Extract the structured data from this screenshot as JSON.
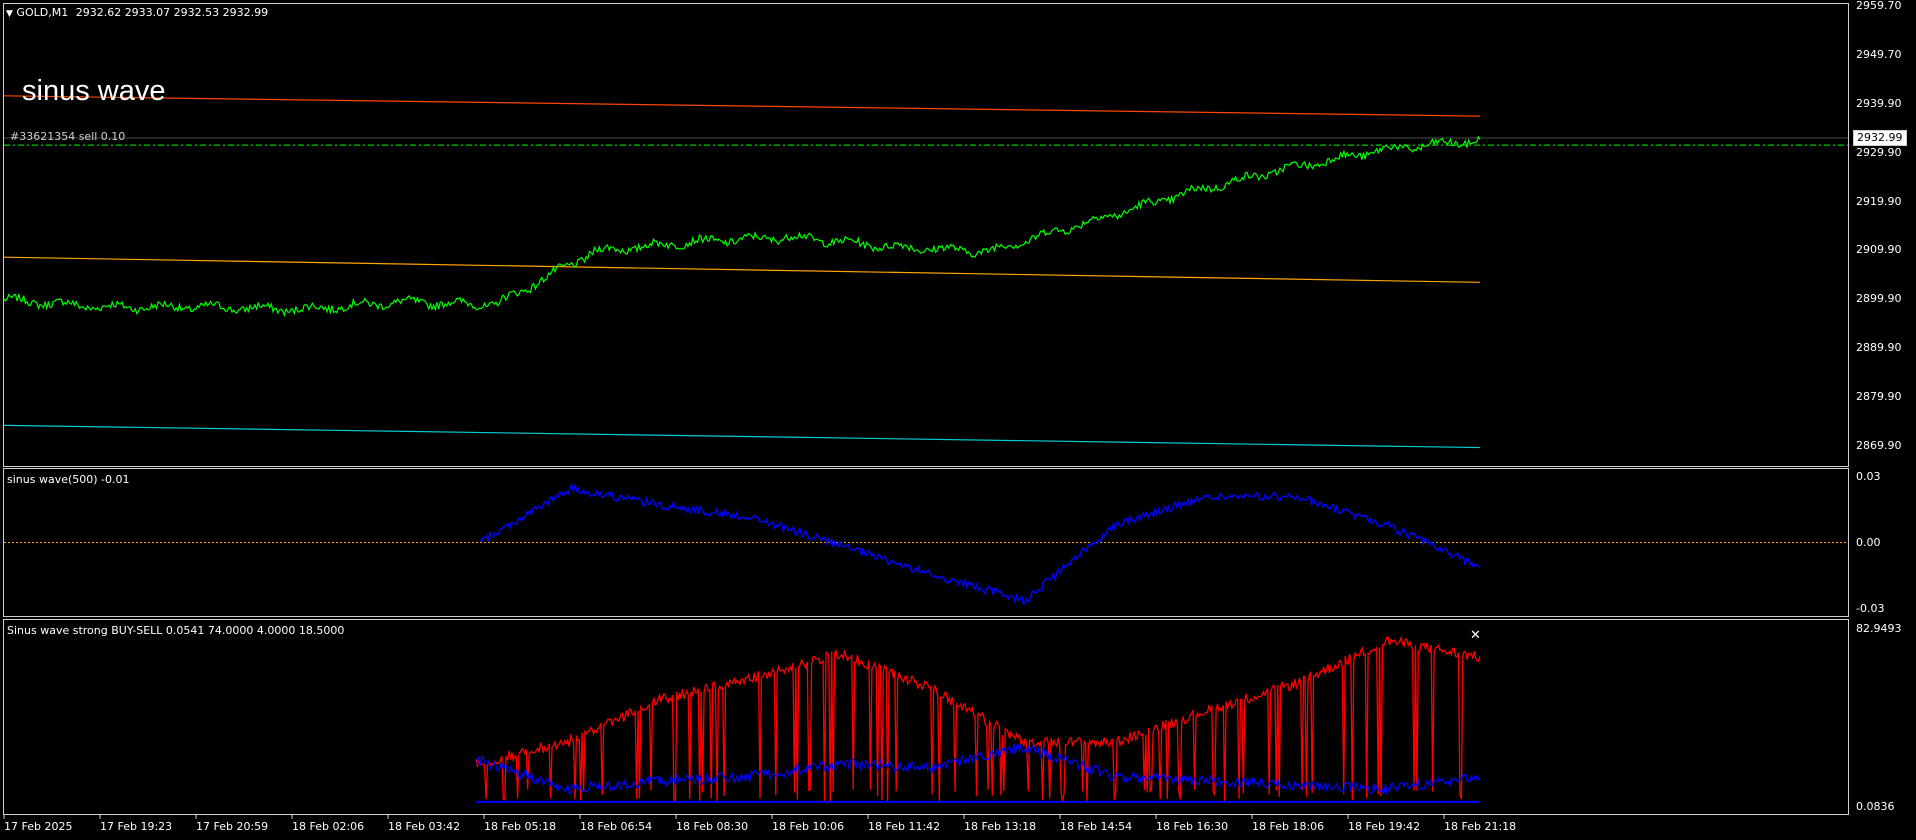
{
  "header": {
    "arrow": "▼",
    "symbol": "GOLD,M1",
    "ohlc": "2932.62 2933.07 2932.53 2932.99"
  },
  "annotation_title": "sinus wave",
  "order_label": "#33621354 sell 0.10",
  "price_axis": [
    "2959.70",
    "2949.70",
    "2939.90",
    "2929.90",
    "2919.90",
    "2909.90",
    "2899.90",
    "2889.90",
    "2879.90",
    "2869.90"
  ],
  "current_price": "2932.99",
  "sine_pane": {
    "title": "sinus wave(500) -0.01",
    "ticks": [
      "0.03",
      "0.00",
      "-0.03"
    ]
  },
  "bs_pane": {
    "title": "Sinus wave strong BUY-SELL 0.0541 74.0000 4.0000 18.5000",
    "ticks": [
      "82.9493",
      "0.0836"
    ]
  },
  "time_axis": [
    "17 Feb 2025",
    "17 Feb 19:23",
    "17 Feb 20:59",
    "18 Feb 02:06",
    "18 Feb 03:42",
    "18 Feb 05:18",
    "18 Feb 06:54",
    "18 Feb 08:30",
    "18 Feb 10:06",
    "18 Feb 11:42",
    "18 Feb 13:18",
    "18 Feb 14:54",
    "18 Feb 16:30",
    "18 Feb 18:06",
    "18 Feb 19:42",
    "18 Feb 21:18"
  ],
  "colors": {
    "price_line": "#00ff00",
    "channel_top": "#ff4500",
    "channel_mid": "#ffa500",
    "channel_low": "#00ced1",
    "order_line": "#00ff00",
    "sine": "#0000ff",
    "zero_line": "#ffa500",
    "buy_sell_red": "#ff0000",
    "buy_sell_blue": "#0000ff"
  },
  "chart_data": [
    {
      "type": "line",
      "title": "GOLD,M1",
      "ylim": [
        2866,
        2961
      ],
      "x": [
        "17 Feb 2025",
        "17 Feb 19:23",
        "17 Feb 20:59",
        "18 Feb 02:06",
        "18 Feb 03:42",
        "18 Feb 05:18",
        "18 Feb 06:54",
        "18 Feb 08:30",
        "18 Feb 10:06",
        "18 Feb 11:42",
        "18 Feb 13:18",
        "18 Feb 14:54",
        "18 Feb 16:30",
        "18 Feb 18:06",
        "18 Feb 19:42",
        "18 Feb 21:18"
      ],
      "series": [
        {
          "values": [
            2900,
            2898.5,
            2898.5,
            2898,
            2899.5,
            2899,
            2910,
            2912,
            2913,
            2911,
            2910,
            2916,
            2922,
            2927,
            2931,
            2932.99
          ]
        }
      ],
      "channels": {
        "top": [
          2942.2,
          2938.0
        ],
        "middle": [
          2908.8,
          2903.6
        ],
        "low": [
          2874.0,
          2869.4
        ]
      },
      "order_line": 2932.0
    },
    {
      "type": "line",
      "title": "sinus wave(500) -0.01",
      "ylim": [
        -0.035,
        0.035
      ],
      "x": [
        "18 Feb 03:42",
        "18 Feb 05:18",
        "18 Feb 06:54",
        "18 Feb 08:30",
        "18 Feb 10:06",
        "18 Feb 11:42",
        "18 Feb 13:18",
        "18 Feb 14:54",
        "18 Feb 16:30",
        "18 Feb 18:06",
        "18 Feb 19:42",
        "18 Feb 21:18"
      ],
      "series": [
        {
          "values": [
            0.0,
            0.026,
            0.018,
            0.012,
            -0.002,
            -0.016,
            -0.028,
            0.009,
            0.022,
            0.022,
            0.008,
            -0.012
          ]
        }
      ]
    },
    {
      "type": "line",
      "title": "Sinus wave strong BUY-SELL 0.0541 74.0000 4.0000 18.5000",
      "ylim": [
        0.0836,
        82.9493
      ],
      "x": [
        "18 Feb 03:42",
        "18 Feb 05:18",
        "18 Feb 06:54",
        "18 Feb 08:30",
        "18 Feb 10:06",
        "18 Feb 11:42",
        "18 Feb 13:18",
        "18 Feb 14:54",
        "18 Feb 16:30",
        "18 Feb 18:06",
        "18 Feb 19:42",
        "18 Feb 21:18"
      ],
      "series": [
        {
          "values": [
            20,
            30,
            50,
            60,
            72,
            55,
            30,
            30,
            45,
            58,
            78,
            70
          ]
        },
        {
          "values": [
            22,
            8,
            12,
            14,
            20,
            18,
            28,
            14,
            12,
            10,
            8,
            14
          ]
        }
      ]
    }
  ]
}
